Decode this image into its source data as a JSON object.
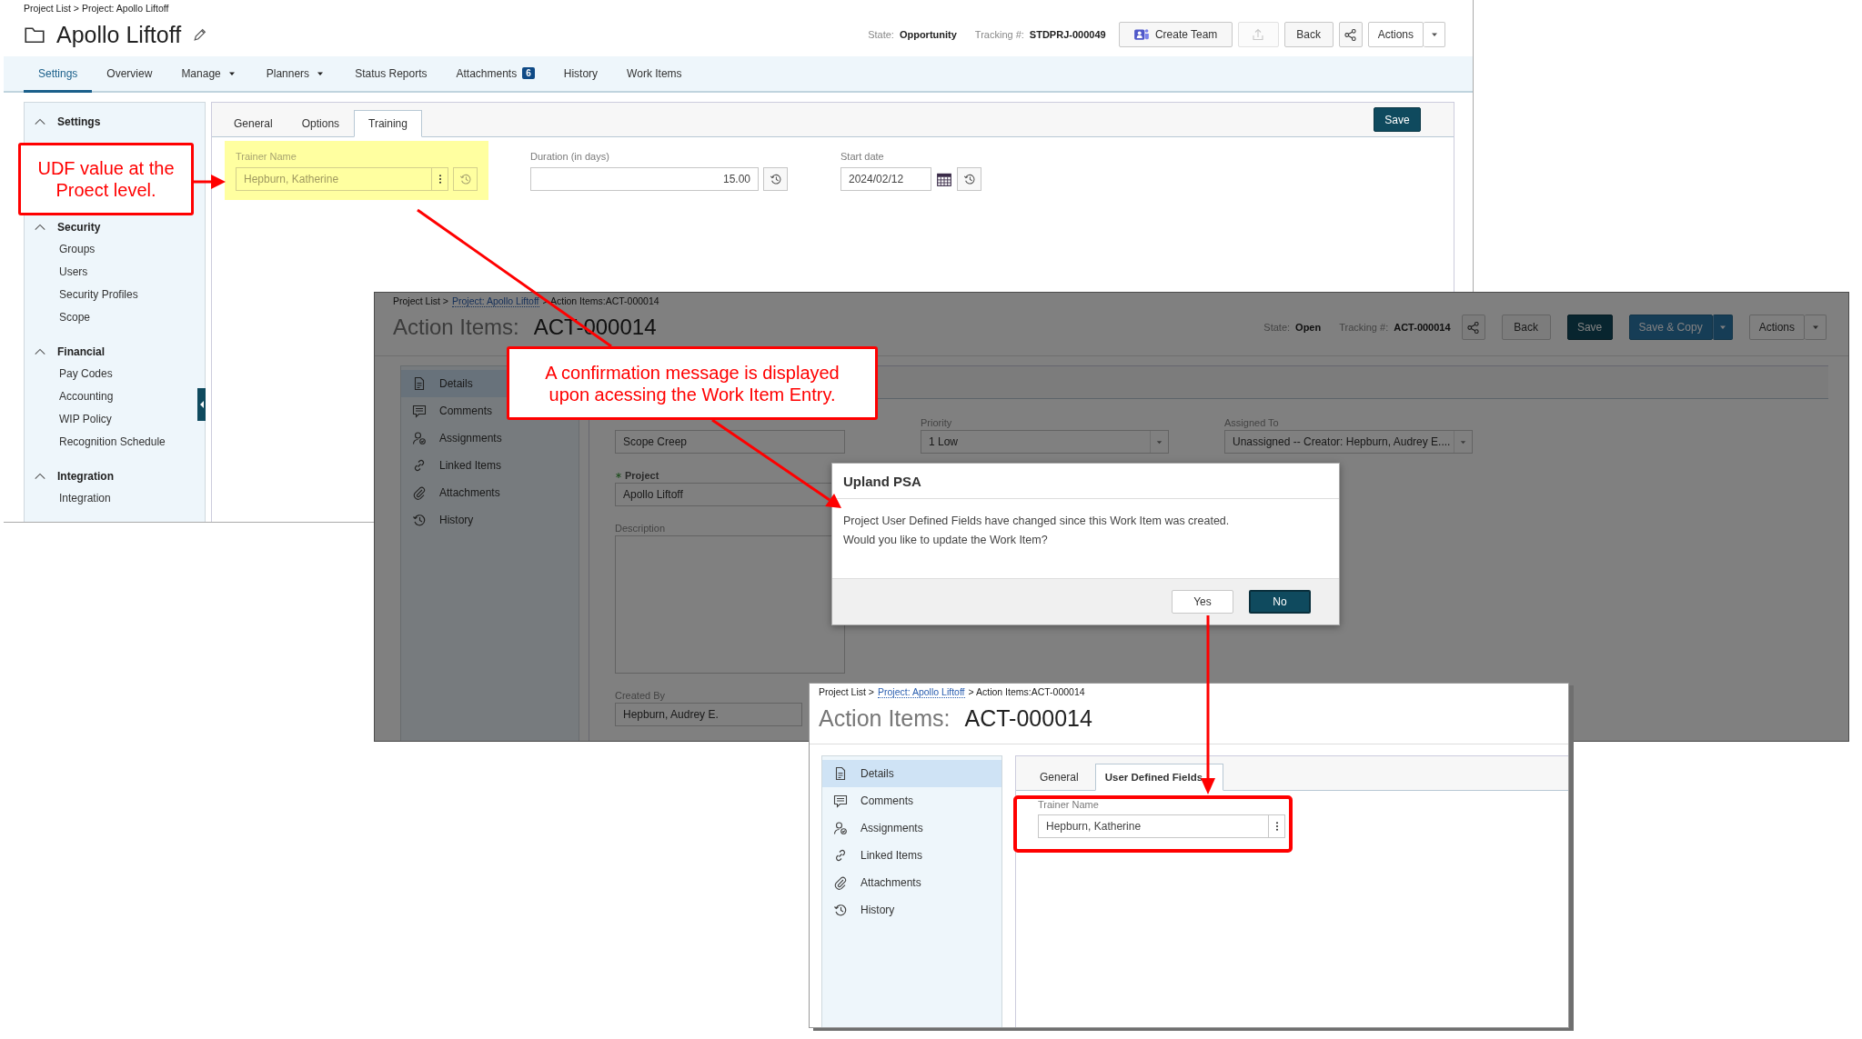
{
  "project_window": {
    "breadcrumb": "Project List > Project: Apollo Liftoff",
    "title": "Apollo Liftoff",
    "state_label": "State:",
    "state": "Opportunity",
    "tracking_label": "Tracking #:",
    "tracking": "STDPRJ-000049",
    "toolbar": [
      {
        "kind": "teams",
        "label": "Create Team",
        "disabled": false
      },
      {
        "kind": "export",
        "disabled": true
      },
      {
        "kind": "text",
        "label": "Back",
        "disabled": false
      },
      {
        "kind": "share",
        "disabled": false
      },
      {
        "kind": "menu",
        "label": "Actions",
        "disabled": false
      }
    ],
    "nav_tabs": [
      {
        "label": "Settings",
        "selected": true
      },
      {
        "label": "Overview",
        "selected": false
      },
      {
        "label": "Manage",
        "selected": false,
        "dropdown": true
      },
      {
        "label": "Planners",
        "selected": false,
        "dropdown": true
      },
      {
        "label": "Status Reports",
        "selected": false
      },
      {
        "label": "Attachments",
        "selected": false,
        "badge": "6"
      },
      {
        "label": "History",
        "selected": false
      },
      {
        "label": "Work Items",
        "selected": false
      }
    ],
    "sidebar": [
      {
        "title": "Settings",
        "expanded": true
      },
      {
        "title": "Security",
        "expanded": true,
        "items": [
          "Groups",
          "Users",
          "Security Profiles",
          "Scope"
        ]
      },
      {
        "title": "Financial",
        "expanded": true,
        "items": [
          "Pay Codes",
          "Accounting",
          "WIP Policy",
          "Recognition Schedule"
        ]
      },
      {
        "title": "Integration",
        "expanded": true,
        "items": [
          "Integration"
        ]
      }
    ],
    "tabs": [
      {
        "label": "General",
        "selected": false
      },
      {
        "label": "Options",
        "selected": false
      },
      {
        "label": "Training",
        "selected": true
      }
    ],
    "save_button": "Save",
    "fields": [
      {
        "kind": "picker",
        "label": "Trainer Name",
        "value": "Hepburn, Katherine",
        "highlighted": true
      },
      {
        "kind": "number",
        "label": "Duration (in days)",
        "value": "15.00",
        "highlighted": false
      },
      {
        "kind": "date",
        "label": "Start date",
        "value": "2024/02/12",
        "highlighted": false
      }
    ]
  },
  "work_item_window": {
    "dimmed": true,
    "breadcrumb": [
      {
        "text": "Project List >",
        "link": false
      },
      {
        "text": "Project: Apollo Liftoff",
        "link": true
      },
      {
        "text": "> Action Items:ACT-000014",
        "link": false
      }
    ],
    "title_label": "Action Items:",
    "title_id": "ACT-000014",
    "state_label": "State:",
    "state": "Open",
    "tracking_label": "Tracking #:",
    "tracking": "ACT-000014",
    "toolbar": [
      {
        "kind": "share"
      },
      {
        "kind": "text",
        "label": "Back"
      },
      {
        "kind": "primary",
        "label": "Save"
      },
      {
        "kind": "split",
        "label": "Save & Copy"
      },
      {
        "kind": "menu",
        "label": "Actions"
      }
    ],
    "sidebar": [
      {
        "label": "Details",
        "selected": true
      },
      {
        "label": "Comments",
        "selected": false
      },
      {
        "label": "Assignments",
        "selected": false
      },
      {
        "label": "Linked Items",
        "selected": false
      },
      {
        "label": "Attachments",
        "selected": false
      },
      {
        "label": "History",
        "selected": false
      }
    ],
    "columns": [
      {
        "fields": [
          {
            "kind": "input",
            "value": "Scope Creep",
            "required": false
          },
          {
            "kind": "input",
            "label": "Project",
            "value": "Apollo Liftoff",
            "required": true
          },
          {
            "kind": "textarea",
            "label": "Description",
            "required": false
          },
          {
            "kind": "input",
            "label": "Created By",
            "value": "Hepburn, Audrey E.",
            "required": false
          }
        ]
      },
      {
        "fields": [
          {
            "kind": "select",
            "label": "Priority",
            "value": "1 Low",
            "required": false
          }
        ]
      },
      {
        "fields": [
          {
            "kind": "select",
            "label": "Assigned To",
            "value": "Unassigned -- Creator: Hepburn, Audrey E....",
            "required": false
          }
        ]
      }
    ]
  },
  "dialog": {
    "title": "Upland PSA",
    "message": [
      "Project User Defined Fields have changed since this Work Item was created.",
      "Would you like to update the Work Item?"
    ],
    "buttons": [
      {
        "label": "Yes",
        "primary": false
      },
      {
        "label": "No",
        "primary": true
      }
    ]
  },
  "updated_window": {
    "breadcrumb": [
      {
        "text": "Project List >",
        "link": false
      },
      {
        "text": "Project: Apollo Liftoff",
        "link": true
      },
      {
        "text": "> Action Items:ACT-000014",
        "link": false
      }
    ],
    "title_label": "Action Items:",
    "title_id": "ACT-000014",
    "sidebar": [
      {
        "label": "Details",
        "selected": true
      },
      {
        "label": "Comments",
        "selected": false
      },
      {
        "label": "Assignments",
        "selected": false
      },
      {
        "label": "Linked Items",
        "selected": false
      },
      {
        "label": "Attachments",
        "selected": false
      },
      {
        "label": "History",
        "selected": false
      }
    ],
    "tabs": [
      {
        "label": "General",
        "selected": false
      },
      {
        "label": "User Defined Fields",
        "selected": true
      }
    ],
    "fields": [
      {
        "kind": "picker",
        "label": "Trainer Name",
        "value": "Hepburn, Katherine"
      }
    ]
  },
  "callouts": [
    {
      "text": "UDF value at the Proect level."
    },
    {
      "text": "A confirmation message is displayed upon acessing the Work Item Entry."
    }
  ]
}
